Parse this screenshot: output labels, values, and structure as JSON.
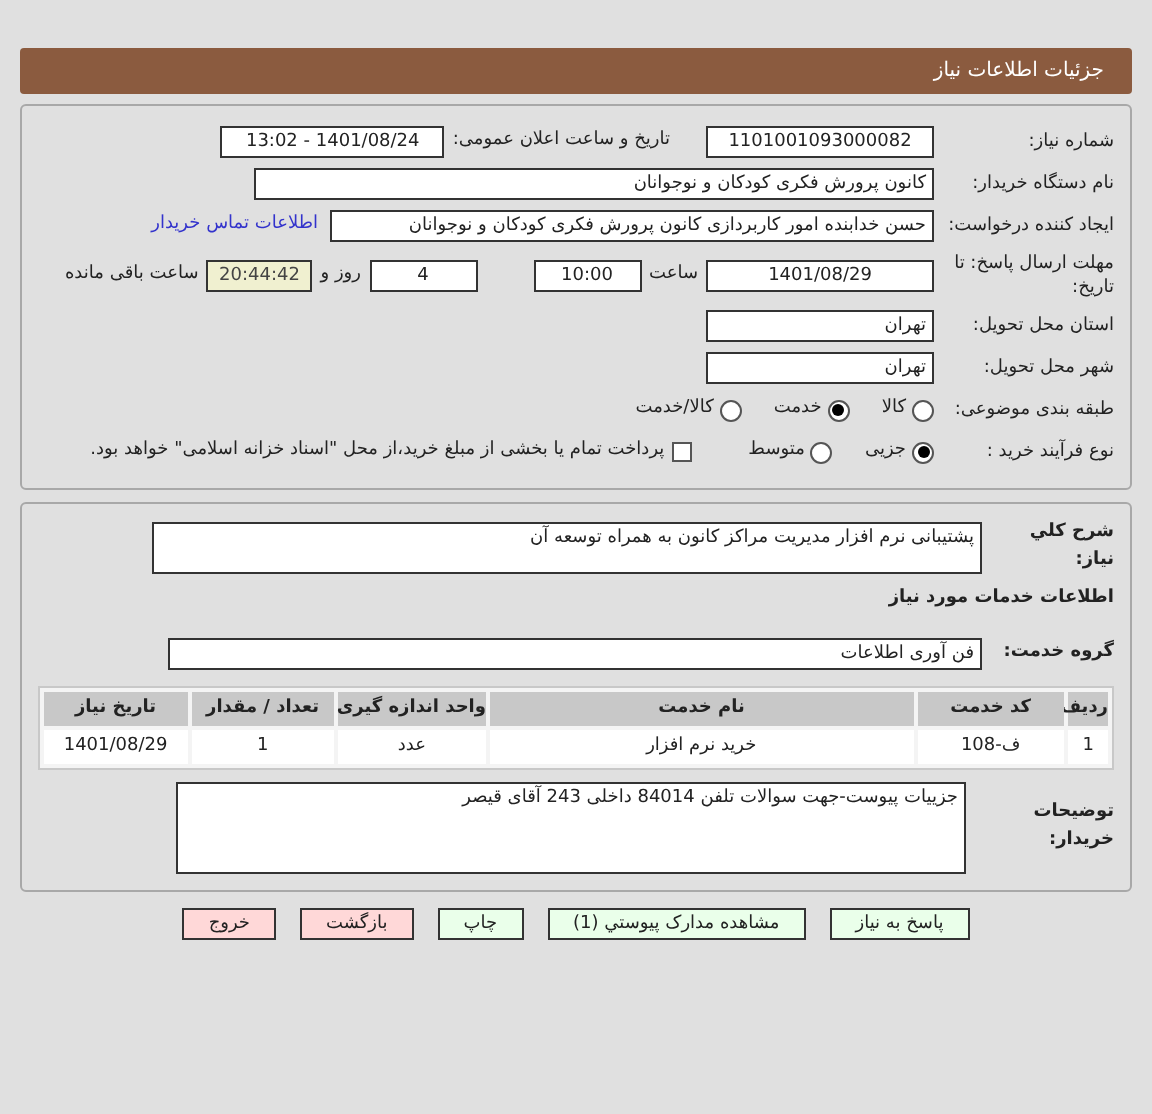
{
  "header": {
    "title": "جزئیات اطلاعات نیاز"
  },
  "details": {
    "need_number": {
      "label": "شماره نیاز:",
      "value": "1101001093000082"
    },
    "announce": {
      "label": "تاریخ و ساعت اعلان عمومی:",
      "value": "1401/08/24 - 13:02"
    },
    "buyer": {
      "label": "نام دستگاه خریدار:",
      "value": "کانون پرورش فکری کودکان و نوجوانان"
    },
    "creator": {
      "label": "ایجاد کننده درخواست:",
      "value": "حسن خدابنده امور کاربردازی  کانون پرورش فکری کودکان و نوجوانان",
      "link": "اطلاعات تماس خریدار"
    },
    "deadline": {
      "label": "مهلت ارسال پاسخ: تا تاریخ:",
      "date": "1401/08/29",
      "time_label": "ساعت",
      "time": "10:00",
      "days": "4",
      "days_label": "روز و",
      "remaining": "20:44:42",
      "remaining_label": "ساعت باقی مانده"
    },
    "province": {
      "label": "استان محل تحویل:",
      "value": "تهران"
    },
    "city": {
      "label": "شهر محل تحویل:",
      "value": "تهران"
    },
    "category": {
      "label": "طبقه بندی موضوعی:",
      "options": [
        {
          "label": "کالا",
          "selected": false
        },
        {
          "label": "خدمت",
          "selected": true
        },
        {
          "label": "کالا/خدمت",
          "selected": false
        }
      ]
    },
    "process": {
      "label": "نوع فرآیند خرید :",
      "options": [
        {
          "label": "جزیی",
          "selected": true
        },
        {
          "label": "متوسط",
          "selected": false
        }
      ],
      "treasury": {
        "label": "پرداخت تمام یا بخشی از مبلغ خرید،از محل \"اسناد خزانه اسلامی\" خواهد بود.",
        "checked": false
      }
    }
  },
  "need": {
    "description_label": "شرح کلي نياز:",
    "description": "پشتیبانی نرم افزار مدیریت مراکز کانون به همراه توسعه آن",
    "services_heading": "اطلاعات خدمات مورد نیاز",
    "group_label": "گروه خدمت:",
    "group": "فن آوری اطلاعات",
    "table": {
      "columns": [
        "ردیف",
        "کد خدمت",
        "نام خدمت",
        "واحد اندازه گیری",
        "تعداد / مقدار",
        "تاریخ نیاز"
      ],
      "rows": [
        [
          "1",
          "ف-108",
          "خرید نرم افزار",
          "عدد",
          "1",
          "1401/08/29"
        ]
      ]
    },
    "notes_label": "توضیحات خریدار:",
    "notes": "جزییات پیوست-جهت سوالات تلفن 84014 داخلی 243 آقای قیصر"
  },
  "buttons": [
    {
      "label": "پاسخ به نیاز",
      "kind": "action"
    },
    {
      "label": "مشاهده مدارک پیوستي (1)",
      "kind": "action"
    },
    {
      "label": "چاپ",
      "kind": "action"
    },
    {
      "label": "بازگشت",
      "kind": "exit"
    },
    {
      "label": "خروج",
      "kind": "exit"
    }
  ]
}
